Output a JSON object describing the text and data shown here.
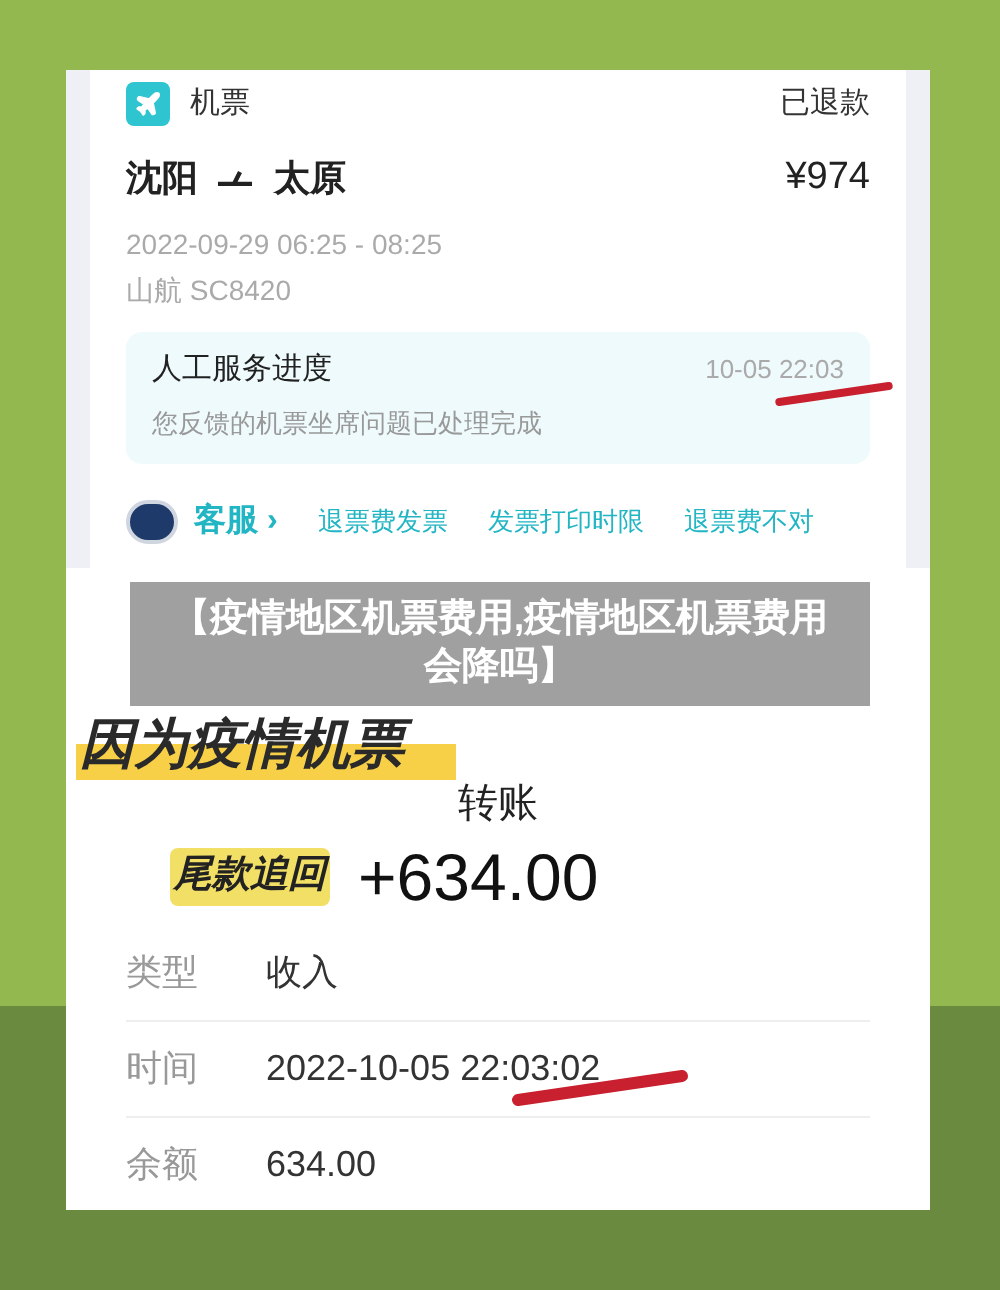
{
  "ticket": {
    "category": "机票",
    "status": "已退款",
    "from": "沈阳",
    "to": "太原",
    "price": "¥974",
    "time": "2022-09-29 06:25 - 08:25",
    "flight": "山航 SC8420"
  },
  "service_progress": {
    "title": "人工服务进度",
    "time": "10-05 22:03",
    "message": "您反馈的机票坐席问题已处理完成"
  },
  "support": {
    "label": "客服",
    "chevron": "›",
    "links": [
      "退票费发票",
      "发票打印时限",
      "退票费不对"
    ]
  },
  "banner": {
    "title": "【疫情地区机票费用,疫情地区机票费用会降吗】"
  },
  "sticker": {
    "caption": "因为疫情机票"
  },
  "transfer": {
    "title": "转账",
    "tag": "尾款追回",
    "amount": "+634.00",
    "details": [
      {
        "label": "类型",
        "value": "收入"
      },
      {
        "label": "时间",
        "value": "2022-10-05 22:03:02"
      },
      {
        "label": "余额",
        "value": "634.00"
      }
    ]
  }
}
